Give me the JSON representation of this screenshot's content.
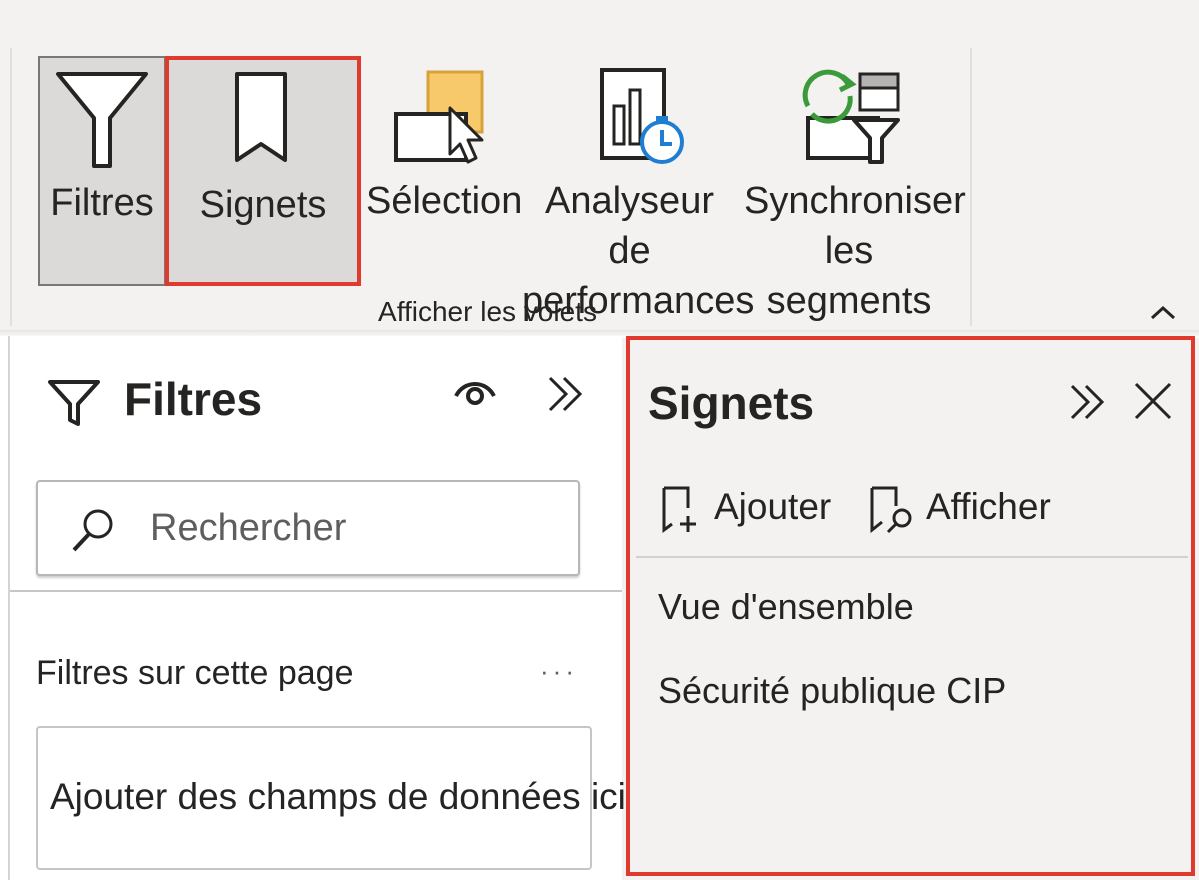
{
  "ribbon": {
    "buttons": {
      "filters": "Filtres",
      "bookmarks": "Signets",
      "selection": "Sélection",
      "performance": "Analyseur de\nperformances",
      "sync_slicers": "Synchroniser\nles segments"
    },
    "group_label": "Afficher les volets",
    "collapse_icon": "chevron-up-icon"
  },
  "filters_pane": {
    "title": "Filtres",
    "title_icon": "filter-icon",
    "visibility_icon": "eye-icon",
    "expand_icon": "double-chevron-right-icon",
    "search": {
      "placeholder": "Rechercher",
      "value": ""
    },
    "section_title": "Filtres sur cette page",
    "more_label": "···",
    "drop_zone_label": "Ajouter des champs de données ici"
  },
  "bookmarks_pane": {
    "title": "Signets",
    "expand_icon": "double-chevron-right-icon",
    "close_icon": "close-icon",
    "actions": {
      "add": "Ajouter",
      "view": "Afficher"
    },
    "items": [
      "Vue d'ensemble",
      "Sécurité publique CIP"
    ]
  },
  "colors": {
    "highlight_border": "#e03a2e",
    "ribbon_background": "#f3f2f1",
    "pressed_button": "#dcdad8",
    "selection_accent": "#f7c96b",
    "perf_clock": "#1f7ed1",
    "sync_arrows": "#3b9b3b"
  }
}
